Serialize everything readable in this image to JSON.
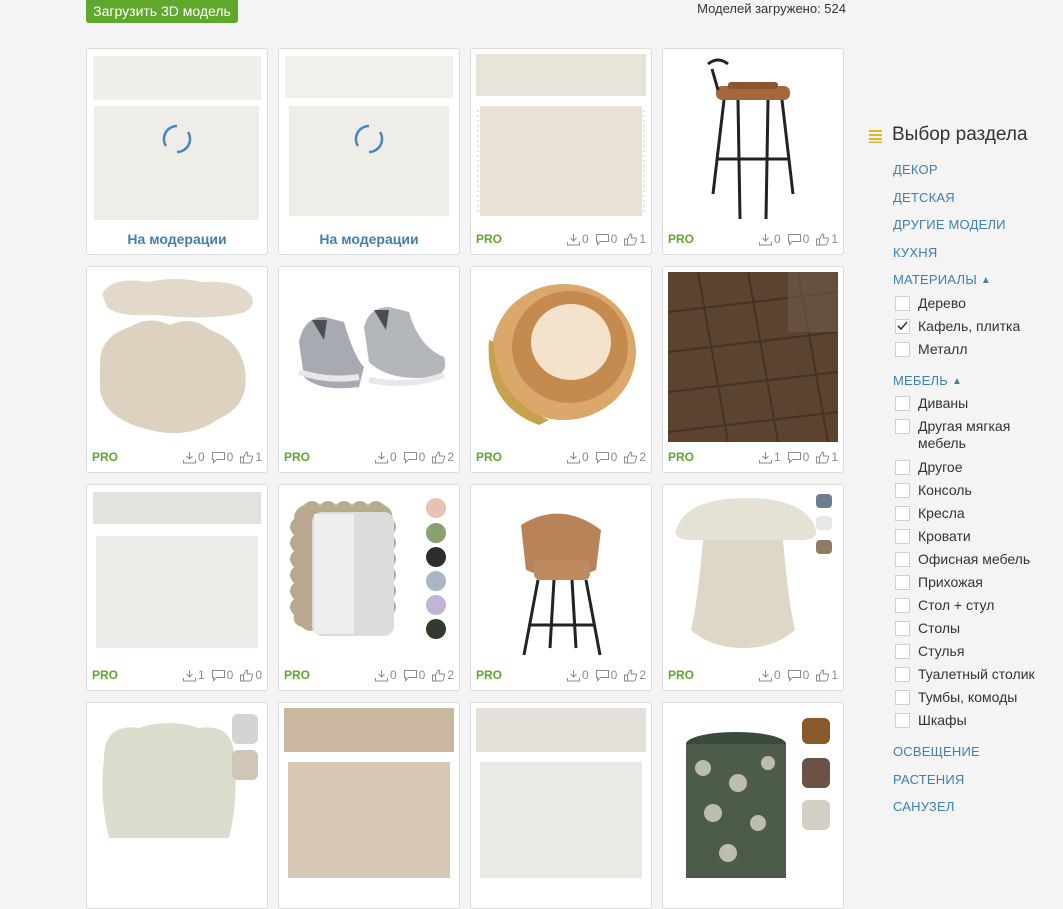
{
  "header": {
    "upload_label": "Загрузить 3D модель",
    "models_count": "Моделей загружено: 524"
  },
  "cards": [
    {
      "image": "rug-cream",
      "moderation": true,
      "footer": "На модерации"
    },
    {
      "image": "rug-cream-2",
      "moderation": true,
      "footer": "На модерации"
    },
    {
      "image": "rug-fringe",
      "pro": "PRO",
      "downloads": "0",
      "comments": "0",
      "likes": "1"
    },
    {
      "image": "bar-stool-leather",
      "pro": "PRO",
      "downloads": "0",
      "comments": "0",
      "likes": "1"
    },
    {
      "image": "rug-cloud",
      "pro": "PRO",
      "downloads": "0",
      "comments": "0",
      "likes": "1"
    },
    {
      "image": "sneakers",
      "pro": "PRO",
      "downloads": "0",
      "comments": "0",
      "likes": "2"
    },
    {
      "image": "glass-cylinder",
      "pro": "PRO",
      "downloads": "0",
      "comments": "0",
      "likes": "2"
    },
    {
      "image": "parquet-herringbone",
      "pro": "PRO",
      "downloads": "1",
      "comments": "0",
      "likes": "1"
    },
    {
      "image": "rug-white",
      "pro": "PRO",
      "downloads": "1",
      "comments": "0",
      "likes": "0"
    },
    {
      "image": "wavy-mirror",
      "pro": "PRO",
      "downloads": "0",
      "comments": "0",
      "likes": "2"
    },
    {
      "image": "bar-chair",
      "pro": "PRO",
      "downloads": "0",
      "comments": "0",
      "likes": "2"
    },
    {
      "image": "mushroom-pouf",
      "pro": "PRO",
      "downloads": "0",
      "comments": "0",
      "likes": "1"
    },
    {
      "image": "pouf-flower"
    },
    {
      "image": "rug-beige"
    },
    {
      "image": "rug-shaggy"
    },
    {
      "image": "pouf-floral"
    }
  ],
  "sidebar": {
    "title": "Выбор раздела",
    "cat_decor": "ДЕКОР",
    "cat_kids": "ДЕТСКАЯ",
    "cat_other_models": "ДРУГИЕ МОДЕЛИ",
    "cat_kitchen": "КУХНЯ",
    "cat_materials": "МАТЕРИАЛЫ",
    "materials": [
      "Дерево",
      "Кафель, плитка",
      "Металл"
    ],
    "cat_furniture": "МЕБЕЛЬ",
    "furniture": [
      "Диваны",
      "Другая мягкая мебель",
      "Другое",
      "Консоль",
      "Кресла",
      "Кровати",
      "Офисная мебель",
      "Прихожая",
      "Стол + стул",
      "Столы",
      "Стулья",
      "Туалетный столик",
      "Тумбы, комоды",
      "Шкафы"
    ],
    "cat_lighting": "ОСВЕЩЕНИЕ",
    "cat_plants": "РАСТЕНИЯ",
    "cat_bathroom": "САНУЗЕЛ"
  },
  "colors": {
    "accent": "#5fa82c",
    "link": "#3f7fb4"
  }
}
